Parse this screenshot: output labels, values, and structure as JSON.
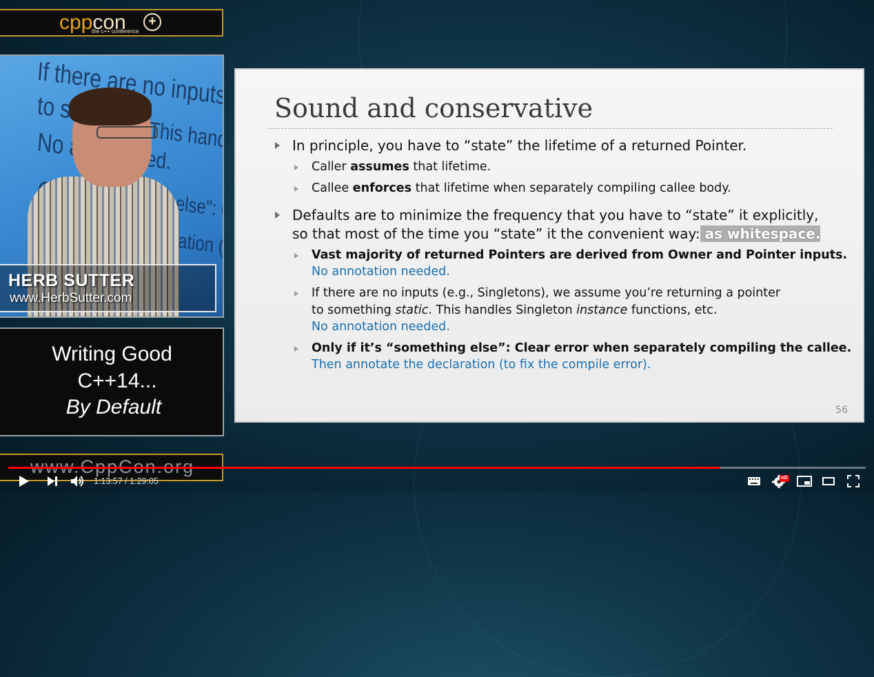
{
  "logo": {
    "main_a": "cpp",
    "main_b": "con",
    "sub": "the c++ conference"
  },
  "speaker": {
    "name": "HERB SUTTER",
    "website": "www.HerbSutter.com",
    "screen_lines": [
      "If there are no inputs (e.g., Singleto",
      "to so",
      "This handles Si",
      "No ann",
      "ed.",
      "Onl",
      "thing else\": Clear",
      "eclaration (to fi"
    ]
  },
  "talk": {
    "line1": "Writing Good",
    "line2": "C++14...",
    "line3": "By Default"
  },
  "site_banner": "www.CppCon.org",
  "slide": {
    "title": "Sound and conservative",
    "bullet1": "In principle, you have to “state” the lifetime of a returned Pointer.",
    "sub1a_pre": "Caller ",
    "sub1a_bold": "assumes",
    "sub1a_post": " that lifetime.",
    "sub1b_pre": "Callee ",
    "sub1b_bold": "enforces",
    "sub1b_post": " that lifetime when separately compiling callee body.",
    "bullet2_line1": "Defaults are to minimize the frequency that you have to “state” it explicitly,",
    "bullet2_line2": "so that most of the time you “state” it the convenient way:",
    "bullet2_ws": " as whitespace.",
    "sub2a": "Vast majority of returned Pointers are derived from Owner and Pointer inputs.",
    "sub2a_blue": "No annotation needed.",
    "sub2b_line1": "If there are no inputs (e.g., Singletons), we assume you’re returning a pointer",
    "sub2b_line2_pre": "to something ",
    "sub2b_line2_it": "static",
    "sub2b_line2_mid": ". This handles Singleton ",
    "sub2b_line2_it2": "instance",
    "sub2b_line2_post": " functions, etc.",
    "sub2b_blue": "No annotation needed.",
    "sub2c": "Only if it’s “something else”: Clear error when separately compiling the callee.",
    "sub2c_blue": "Then annotate the declaration (to fix the compile error).",
    "page_number": "56"
  },
  "player": {
    "current_time": "1:13:57",
    "duration": "1:29:05",
    "time_separator": " / ",
    "progress_fraction": 0.83,
    "quality_badge": "HD",
    "accent_color": "#ff0000",
    "icons": [
      "play-icon",
      "next-icon",
      "volume-icon",
      "keyboard-icon",
      "settings-icon",
      "miniplayer-icon",
      "theater-icon",
      "fullscreen-icon"
    ]
  }
}
